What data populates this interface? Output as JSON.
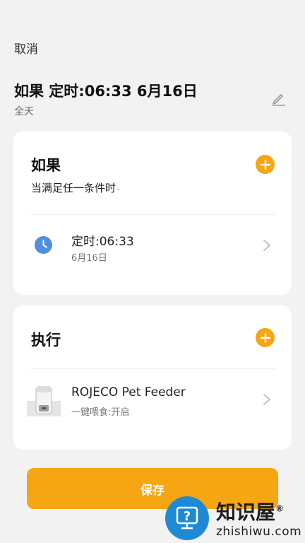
{
  "header": {
    "cancel_label": "取消",
    "title": "如果 定时:06:33 6月16日",
    "subtitle": "全天"
  },
  "if_section": {
    "title": "如果",
    "condition_mode": "当满足任一条件时",
    "items": [
      {
        "title": "定时:06:33",
        "subtitle": "6月16日",
        "icon": "clock-icon"
      }
    ]
  },
  "do_section": {
    "title": "执行",
    "items": [
      {
        "title": "ROJECO Pet Feeder",
        "subtitle": "一键喂食:开启",
        "icon": "pet-feeder-image"
      }
    ]
  },
  "save_label": "保存",
  "watermark": {
    "name": "知识屋",
    "registered": "®",
    "domain": "zhishiwu.com"
  },
  "colors": {
    "accent": "#f6a513",
    "clock": "#4f8fdc",
    "background": "#f2f2f2",
    "card": "#ffffff",
    "watermark_blue": "#1e8ad6"
  }
}
